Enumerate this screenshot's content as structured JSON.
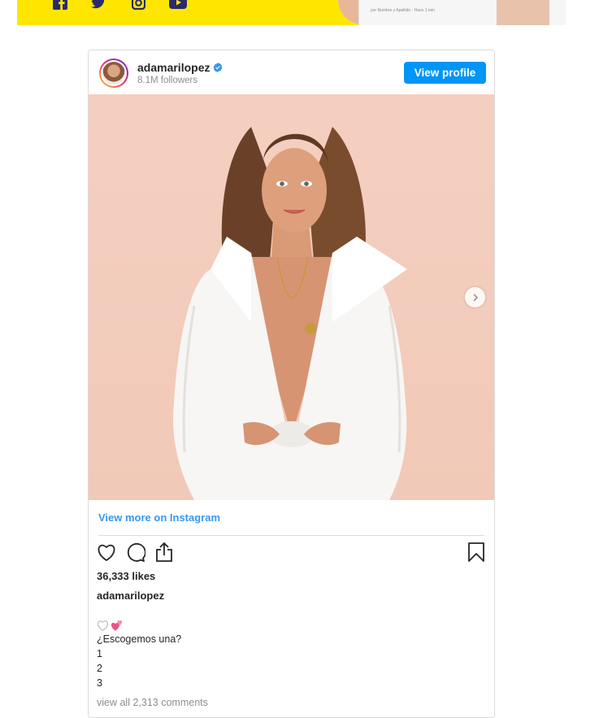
{
  "banner": {
    "background": "#ffe600",
    "icon_color": "#2a2a6c",
    "social_icons": [
      "facebook-icon",
      "twitter-icon",
      "instagram-icon",
      "youtube-icon"
    ],
    "card_text": "por Nombre y Apellido · Hace 1 min"
  },
  "post": {
    "username": "adamarilopez",
    "verified": true,
    "followers": "8.1M followers",
    "view_profile_label": "View profile",
    "view_more_label": "View more on Instagram",
    "likes": "36,333 likes",
    "caption_user": "adamarilopez",
    "caption_lines": [
      "¿Escogemos una?",
      "1",
      "2",
      "3"
    ],
    "comments_link": "view all 2,313 comments",
    "icons": [
      "heart-icon",
      "comment-icon",
      "share-icon",
      "bookmark-icon",
      "carousel-next-icon"
    ],
    "caption_emoji": [
      "white-heart-emoji",
      "two-hearts-emoji"
    ],
    "colors": {
      "accent": "#0095f6",
      "link": "#3897f0",
      "text": "#262626",
      "muted": "#8e8e8e",
      "verified": "#3897f0"
    }
  }
}
